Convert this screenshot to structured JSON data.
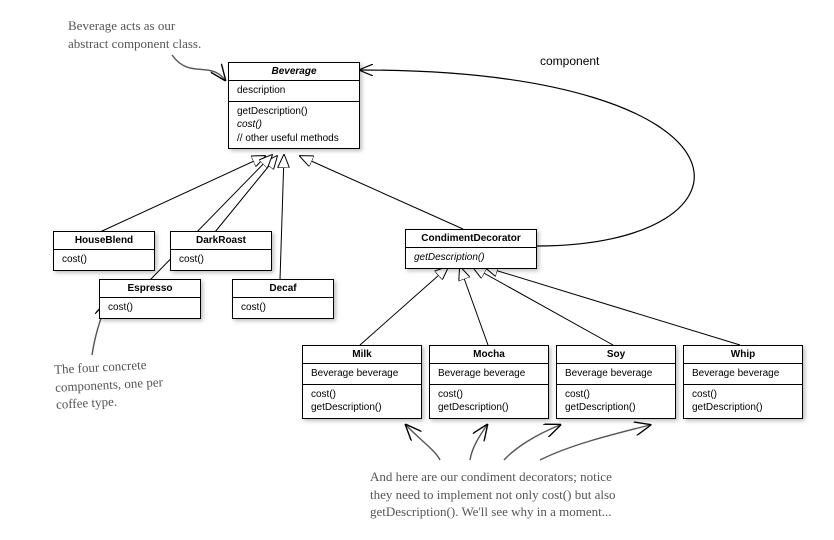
{
  "notes": {
    "abstract_component": "Beverage acts as our\nabstract component class.",
    "concrete_components": "The four concrete\ncomponents, one per\ncoffee type.",
    "condiment_decorators": "And here are our condiment decorators; notice\nthey need to implement not only cost() but also\ngetDescription(). We'll see why in a moment..."
  },
  "labels": {
    "component": "component"
  },
  "classes": {
    "beverage": {
      "name": "Beverage",
      "attrs": {
        "description": "description"
      },
      "methods": {
        "getDescription": "getDescription()",
        "cost": "cost()",
        "other": "// other useful methods"
      }
    },
    "houseBlend": {
      "name": "HouseBlend",
      "method": "cost()"
    },
    "darkRoast": {
      "name": "DarkRoast",
      "method": "cost()"
    },
    "espresso": {
      "name": "Espresso",
      "method": "cost()"
    },
    "decaf": {
      "name": "Decaf",
      "method": "cost()"
    },
    "condimentDecorator": {
      "name": "CondimentDecorator",
      "method": "getDescription()"
    },
    "milk": {
      "name": "Milk",
      "attr": "Beverage beverage",
      "m1": "cost()",
      "m2": "getDescription()"
    },
    "mocha": {
      "name": "Mocha",
      "attr": "Beverage beverage",
      "m1": "cost()",
      "m2": "getDescription()"
    },
    "soy": {
      "name": "Soy",
      "attr": "Beverage beverage",
      "m1": "cost()",
      "m2": "getDescription()"
    },
    "whip": {
      "name": "Whip",
      "attr": "Beverage beverage",
      "m1": "cost()",
      "m2": "getDescription()"
    }
  }
}
